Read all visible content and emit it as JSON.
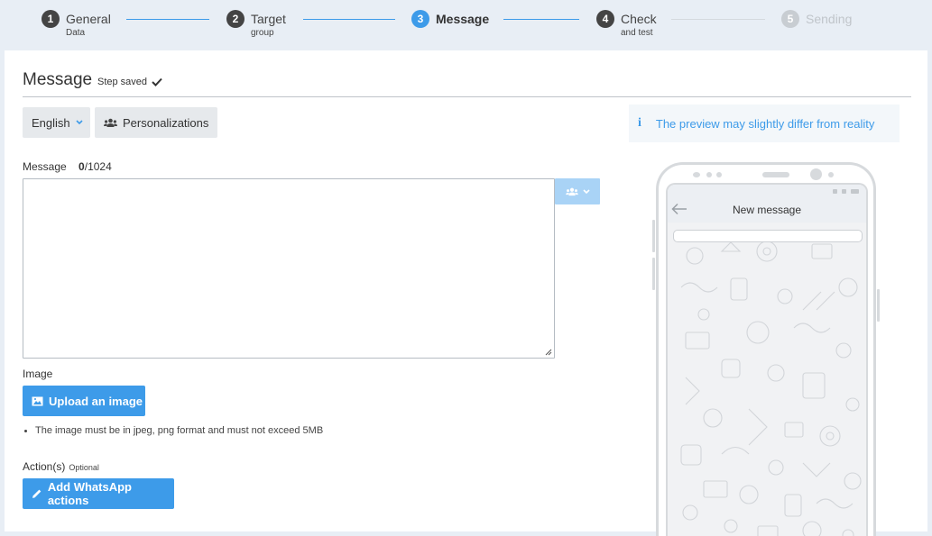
{
  "steps": [
    {
      "num": "1",
      "title": "General",
      "sub": "Data"
    },
    {
      "num": "2",
      "title": "Target",
      "sub": "group"
    },
    {
      "num": "3",
      "title": "Message",
      "sub": ""
    },
    {
      "num": "4",
      "title": "Check",
      "sub": "and test"
    },
    {
      "num": "5",
      "title": "Sending",
      "sub": ""
    }
  ],
  "page": {
    "title": "Message",
    "saved": "Step saved"
  },
  "toolbar": {
    "language": "English",
    "personalizations": "Personalizations"
  },
  "info": {
    "icon": "i",
    "text": "The preview may slightly differ from reality"
  },
  "message": {
    "label": "Message",
    "count": "0",
    "max": "/1024",
    "value": ""
  },
  "image": {
    "label": "Image",
    "upload": "Upload an image",
    "note": "The image must be in jpeg, png format and must not exceed 5MB"
  },
  "actions": {
    "label": "Action(s)",
    "optional": "Optional",
    "button": "Add WhatsApp actions"
  },
  "preview": {
    "header": "New message"
  },
  "colors": {
    "accent": "#3d9be9",
    "accent_light": "#a9d3f6",
    "background": "#e8eef5"
  }
}
